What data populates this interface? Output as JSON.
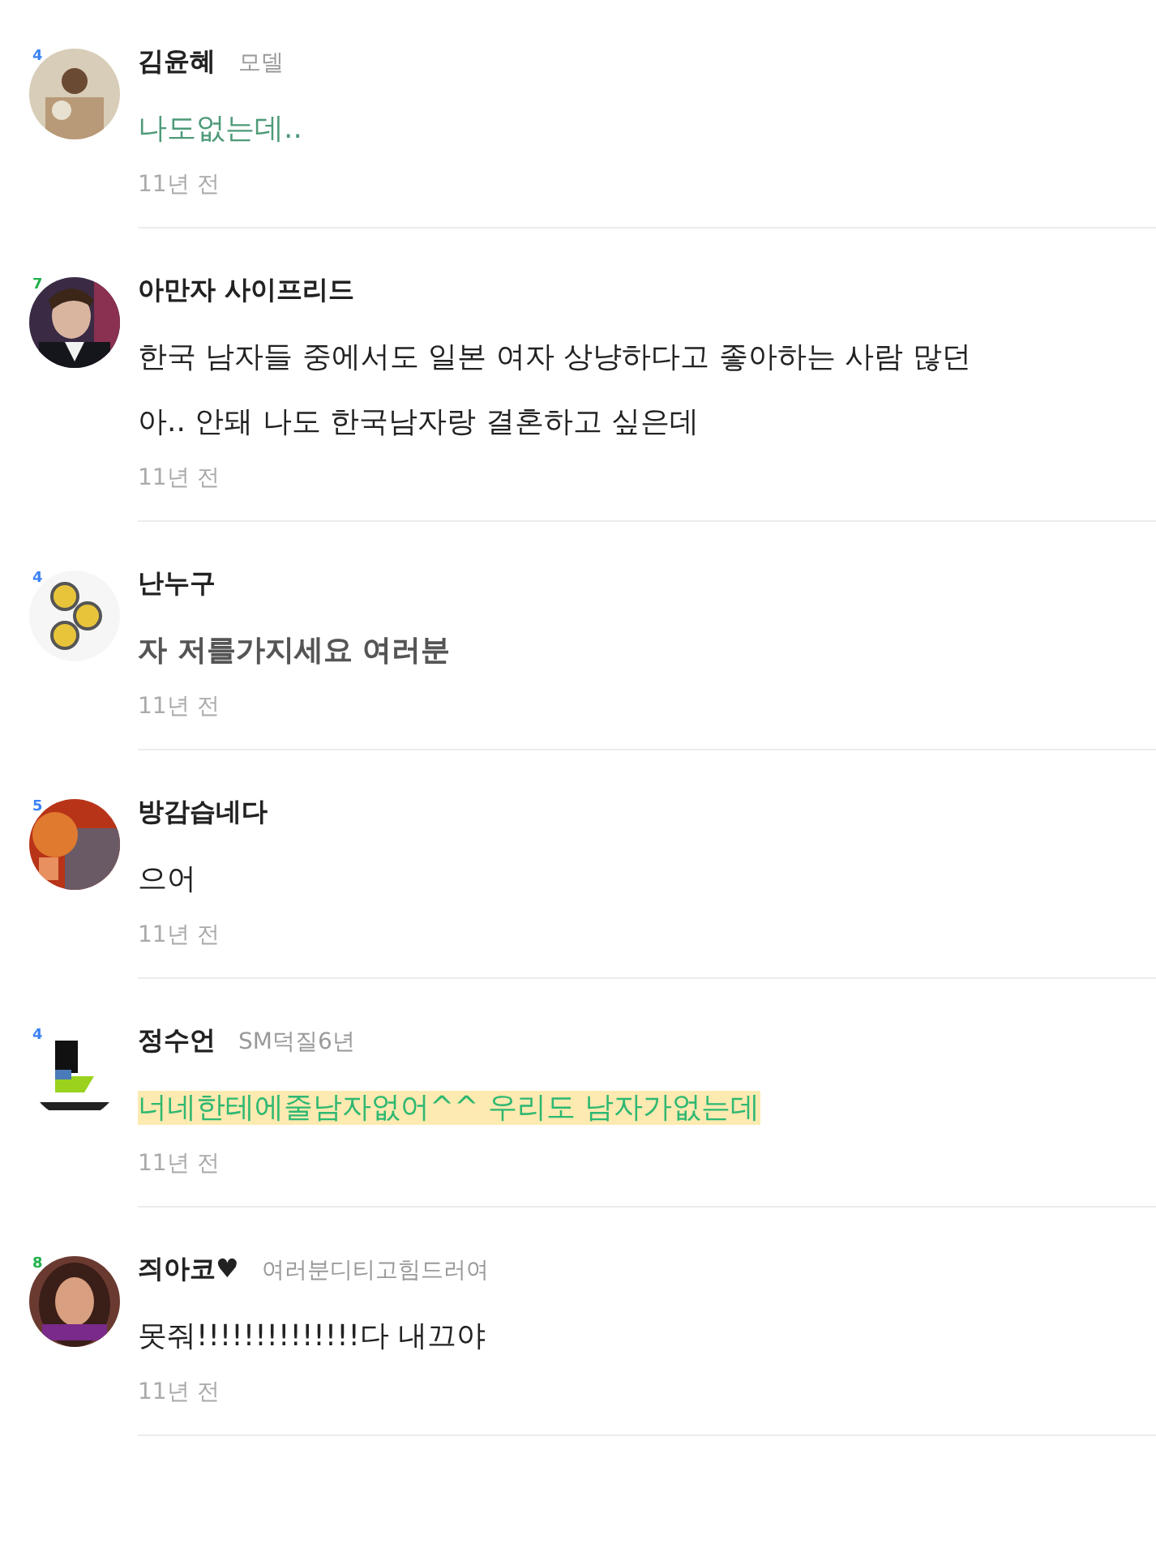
{
  "comments": [
    {
      "level": "4",
      "color": "#3b82f6",
      "name": "김윤혜",
      "tag": "모델",
      "lines": [
        {
          "kind": "green",
          "text": "나도없는데.."
        }
      ],
      "time": "11년 전"
    },
    {
      "level": "7",
      "color": "#22b14c",
      "name": "아만자 사이프리드",
      "lines": [
        {
          "kind": "plain",
          "text": "한국 남자들 중에서도 일본 여자 상냥하다고 좋아하는 사람 많던"
        },
        {
          "kind": "plain",
          "text": "아.. 안돼 나도 한국남자랑 결혼하고 싶은데"
        }
      ],
      "time": "11년 전"
    },
    {
      "level": "4",
      "color": "#3b82f6",
      "name": "난누구",
      "lines": [
        {
          "kind": "bold",
          "text": "자 저를가지세요 여러분"
        }
      ],
      "time": "11년 전"
    },
    {
      "level": "5",
      "color": "#3b82f6",
      "name": "방감습네다",
      "lines": [
        {
          "kind": "plain",
          "text": "으어"
        }
      ],
      "time": "11년 전"
    },
    {
      "level": "4",
      "color": "#3b82f6",
      "name": "정수언",
      "tag": "SM덕질6년",
      "lines": [
        {
          "kind": "highlight",
          "text": "너네한테에줄남자없어^^ 우리도 남자가없는데"
        }
      ],
      "time": "11년 전"
    },
    {
      "level": "8",
      "color": "#22b14c",
      "name": "즤아코♥",
      "tag": "여러분디티고힘드러여",
      "lines": [
        {
          "kind": "plain",
          "text": "못줘!!!!!!!!!!!!!!다 내끄야"
        }
      ],
      "time": "11년 전"
    }
  ]
}
